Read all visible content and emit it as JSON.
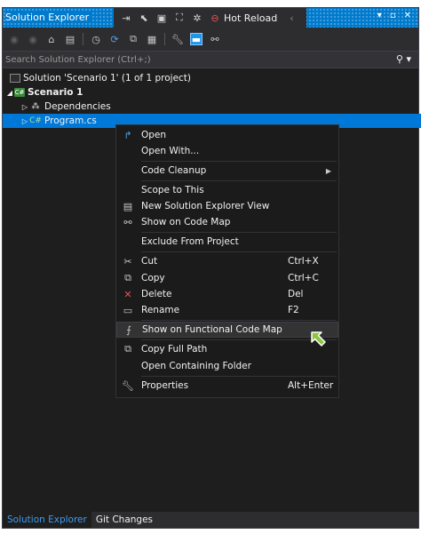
{
  "window": {
    "title": "Solution Explorer"
  },
  "hot_reload": {
    "label": "Hot Reload"
  },
  "search": {
    "placeholder": "Search Solution Explorer (Ctrl+;)"
  },
  "tree": {
    "solution": "Solution 'Scenario 1' (1 of 1 project)",
    "project": "Scenario 1",
    "project_icon": "C#",
    "dependencies": "Dependencies",
    "file": "Program.cs",
    "file_icon": "C#"
  },
  "menu": {
    "open": "Open",
    "open_with": "Open With...",
    "code_cleanup": "Code Cleanup",
    "scope_to_this": "Scope to This",
    "new_view": "New Solution Explorer View",
    "show_code_map": "Show on Code Map",
    "exclude": "Exclude From Project",
    "cut": "Cut",
    "cut_shortcut": "Ctrl+X",
    "copy": "Copy",
    "copy_shortcut": "Ctrl+C",
    "delete": "Delete",
    "delete_shortcut": "Del",
    "rename": "Rename",
    "rename_shortcut": "F2",
    "functional_map": "Show on Functional Code Map",
    "copy_full_path": "Copy Full Path",
    "open_folder": "Open Containing Folder",
    "properties": "Properties",
    "properties_shortcut": "Alt+Enter"
  },
  "tabs": {
    "solution_explorer": "Solution Explorer",
    "git_changes": "Git Changes"
  },
  "colors": {
    "accent": "#007acc",
    "selection": "#0078d7",
    "background": "#1e1e1e",
    "menu": "#1b1b1c"
  }
}
